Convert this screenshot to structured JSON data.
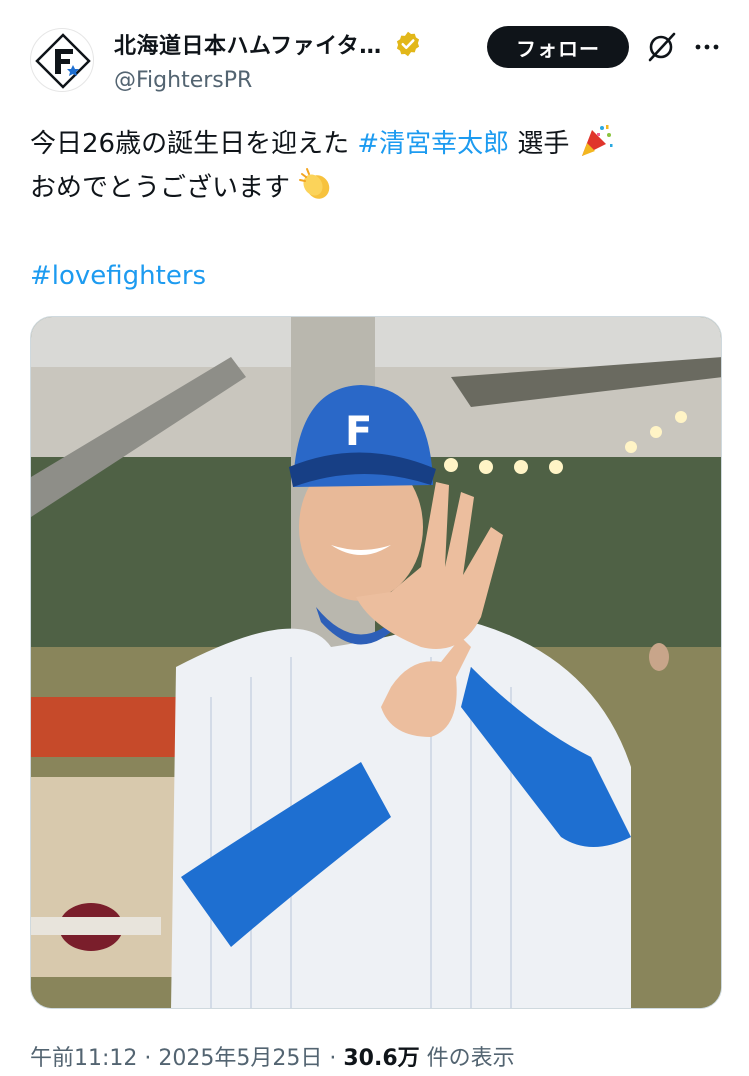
{
  "account": {
    "display_name": "北海道日本ハムファイタ…",
    "handle": "@FightersPR",
    "avatar_icon": "fighters-f-logo-icon",
    "verified_badge": "gold-verified-icon",
    "follow_label": "フォロー"
  },
  "icons": {
    "grok": "grok-icon",
    "more": "more-icon"
  },
  "post": {
    "line1_text": "今日26歳の誕生日を迎えた ",
    "line1_hashtag": "#清宮幸太郎",
    "line1_suffix": " 選手",
    "line1_emoji": "party-popper-icon",
    "line2_text": "おめでとうございます",
    "line2_emoji": "clapping-hands-icon",
    "hashtag": "#lovefighters"
  },
  "media": {
    "description_icon": "photo",
    "cap_letter": "F"
  },
  "meta": {
    "time": "午前11:12",
    "sep": " · ",
    "date": "2025年5月25日",
    "views": "30.6万",
    "views_suffix": " 件の表示"
  },
  "colors": {
    "link": "#1d9bf0",
    "text": "#0f1419",
    "muted": "#536471",
    "verified": "#e2b719",
    "fighters_blue": "#1e6fd1"
  }
}
